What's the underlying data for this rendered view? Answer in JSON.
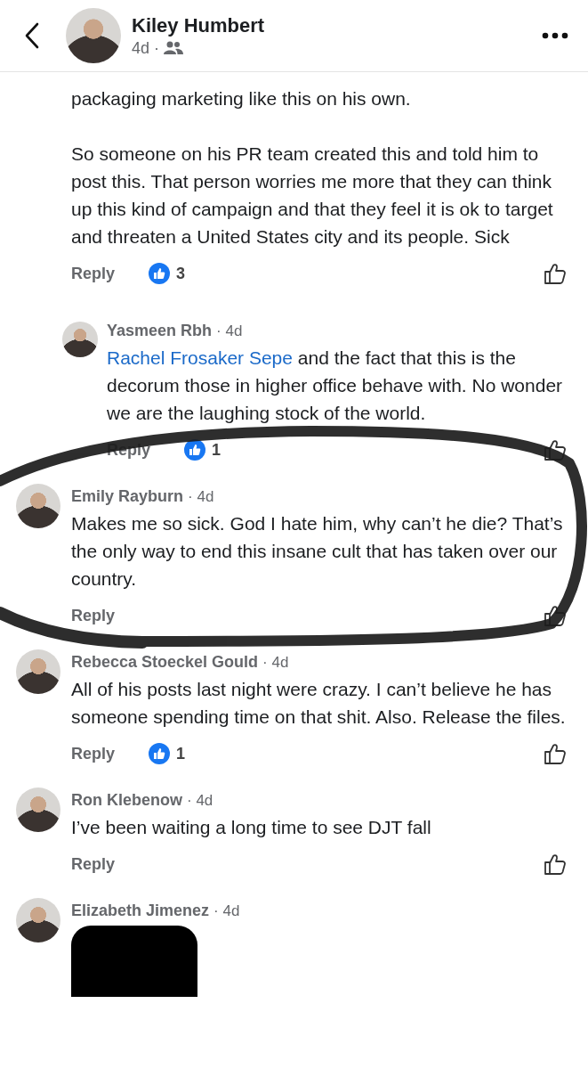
{
  "header": {
    "author": "Kiley Humbert",
    "time": "4d",
    "separator": "·"
  },
  "comments": [
    {
      "kind": "partial",
      "paragraphs": [
        "packaging marketing like this on his own.",
        "So someone on his PR team created this and told him to post this. That person worries me more that they can think up this kind of campaign and that they feel it is ok to target and threaten a United States city and its people. Sick"
      ],
      "reply_label": "Reply",
      "likes": "3",
      "children": [
        {
          "kind": "full",
          "author": "Yasmeen Rbh",
          "time": "· 4d",
          "mention": "Rachel Frosaker Sepe",
          "text": "and the fact that this is the decorum those in higher office behave with. No wonder we are the laughing stock of the world.",
          "reply_label": "Reply",
          "likes": "1"
        }
      ]
    },
    {
      "kind": "full",
      "author": "Emily Rayburn",
      "time": "· 4d",
      "text": "Makes me so sick.  God I hate him, why can’t he die? That’s the only way to end this insane cult that has taken over our country.",
      "reply_label": "Reply"
    },
    {
      "kind": "full",
      "author": "Rebecca Stoeckel Gould",
      "time": "· 4d",
      "text": "All of his posts last night were crazy. I can’t believe he has someone spending time on that shit. Also. Release the files.",
      "reply_label": "Reply",
      "likes": "1"
    },
    {
      "kind": "full",
      "author": "Ron Klebenow",
      "time": "· 4d",
      "text": "I’ve been waiting a long time to see DJT  fall",
      "reply_label": "Reply"
    },
    {
      "kind": "image",
      "author": "Elizabeth Jimenez",
      "time": "· 4d"
    }
  ]
}
